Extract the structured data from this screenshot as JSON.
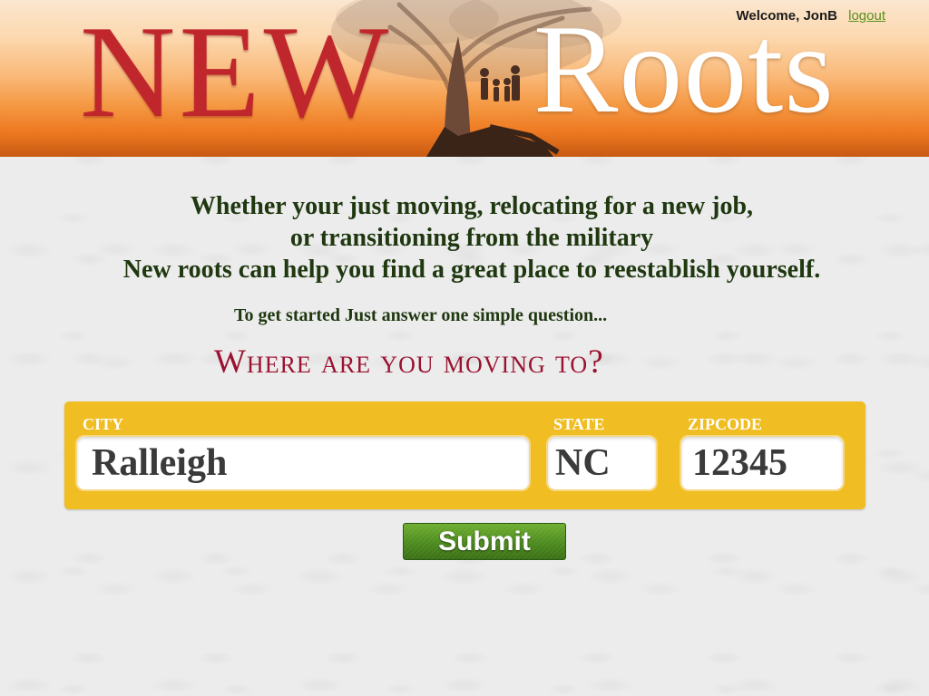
{
  "header": {
    "logo_new": "NEW",
    "logo_roots": "Roots",
    "welcome_text": "Welcome, JonB",
    "logout_label": "logout"
  },
  "intro": {
    "lines": [
      "Whether your just moving, relocating for a new job,",
      "or transitioning from the military",
      "New roots can help you find a great place to reestablish yourself."
    ],
    "prompt": "To get started Just answer one simple question...",
    "question": "Where are you moving to?"
  },
  "form": {
    "city_label": "CITY",
    "city_value": "Ralleigh",
    "state_label": "STATE",
    "state_value": "NC",
    "zip_label": "ZIPCODE",
    "zip_value": "12345",
    "submit_label": "Submit"
  },
  "colors": {
    "logo_red": "#c0272d",
    "panel_gold": "#f0bd22",
    "text_green": "#1f3810",
    "heading_crimson": "#9b1230",
    "button_green": "#4b8a1d",
    "logout_green": "#5a8f1c"
  }
}
